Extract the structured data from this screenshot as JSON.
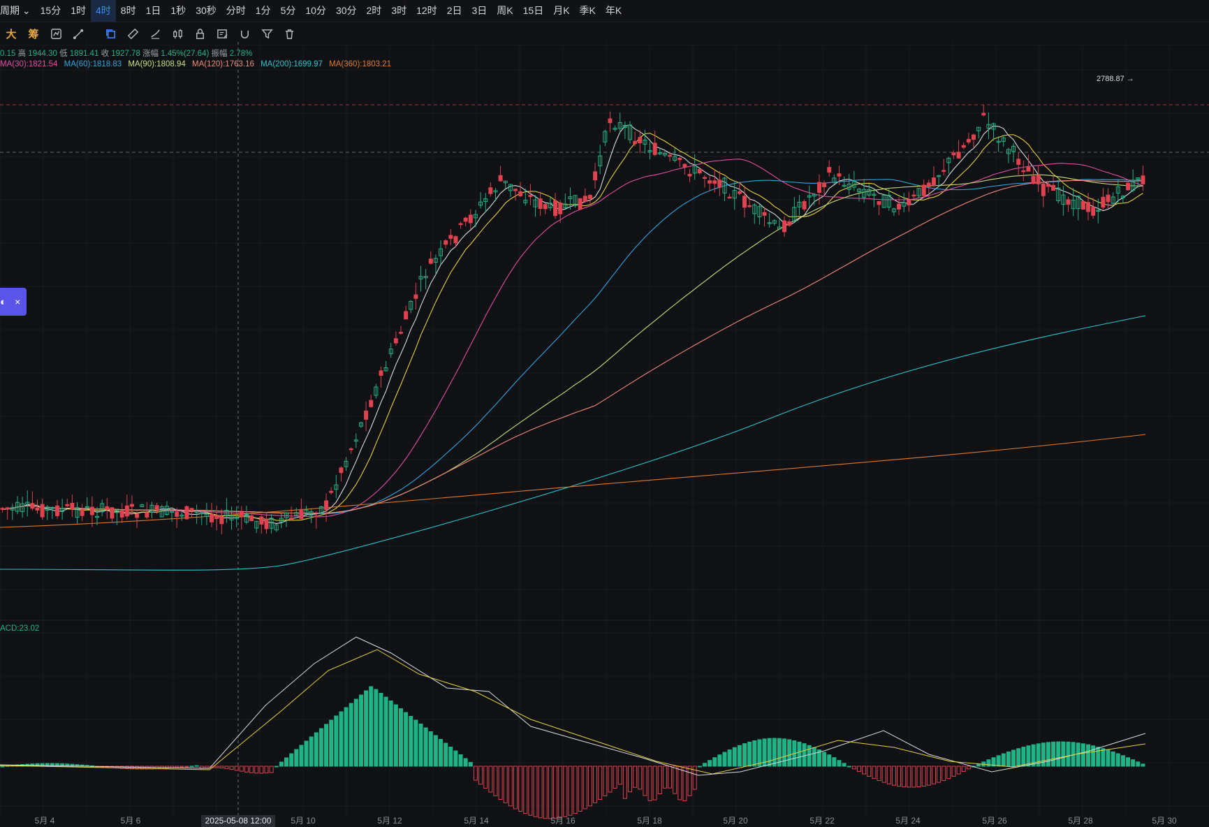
{
  "toolbar": {
    "lead": "周期",
    "periods": [
      "15分",
      "1时",
      "4时",
      "8时",
      "1日",
      "1秒",
      "30秒",
      "分时",
      "1分",
      "5分",
      "10分",
      "30分",
      "2时",
      "3时",
      "12时",
      "2日",
      "3日",
      "周K",
      "15日",
      "月K",
      "季K",
      "年K"
    ],
    "active": "4时"
  },
  "drawing_tools": {
    "text_a": "大",
    "text_b": "筹",
    "icons": [
      "indicator-icon",
      "drawing-icon",
      "ruler-icon",
      "brush-icon",
      "candle-style-icon",
      "lock-icon",
      "note-icon",
      "magnet-icon",
      "filter-icon",
      "trash-icon"
    ]
  },
  "ohlc": {
    "open": "0.15",
    "high_label": "高",
    "high": "1944.30",
    "low_label": "低",
    "low": "1891.41",
    "close_label": "收",
    "close": "1927.78",
    "change_label": "涨幅",
    "change": "1.45%(27.64)",
    "amp_label": "振幅",
    "amp": "2.78%"
  },
  "ma_legend": [
    {
      "label": "MA(30):1821.54",
      "color": "#e04fa6"
    },
    {
      "label": "MA(60):1818.83",
      "color": "#2fa6e0"
    },
    {
      "label": "MA(90):1808.94",
      "color": "#c8e07a"
    },
    {
      "label": "MA(120):1763.16",
      "color": "#f08a7a"
    },
    {
      "label": "MA(200):1699.97",
      "color": "#26c6d0"
    },
    {
      "label": "MA(360):1803.21",
      "color": "#e07a2a"
    }
  ],
  "macd_label": "ACD:23.02",
  "chip": {
    "dot": "◐",
    "close": "×"
  },
  "price_annotation": "2788.87 →",
  "x_labels": [
    "5月 4",
    "5月 6",
    "5月 10",
    "5月 12",
    "5月 14",
    "5月 16",
    "5月 18",
    "5月 20",
    "5月 22",
    "5月 24",
    "5月 26",
    "5月 28",
    "5月 30"
  ],
  "crosshair_label": "2025-05-08 12:00",
  "colors": {
    "up": "#1fb387",
    "down": "#e0424f",
    "background": "#101114",
    "accent": "#3d8bfd"
  }
}
